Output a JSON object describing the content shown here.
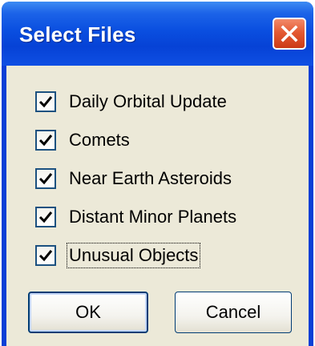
{
  "dialog": {
    "title": "Select Files",
    "close_icon": "close-x-icon",
    "colors": {
      "titlebar": "#0a4fe0",
      "close_button": "#e45a33",
      "client_background": "#ece9d8"
    }
  },
  "options": [
    {
      "label": "Daily Orbital Update",
      "checked": true
    },
    {
      "label": "Comets",
      "checked": true
    },
    {
      "label": "Near Earth Asteroids",
      "checked": true
    },
    {
      "label": "Distant Minor Planets",
      "checked": true
    },
    {
      "label": "Unusual Objects",
      "checked": true
    }
  ],
  "buttons": {
    "ok_label": "OK",
    "cancel_label": "Cancel"
  }
}
